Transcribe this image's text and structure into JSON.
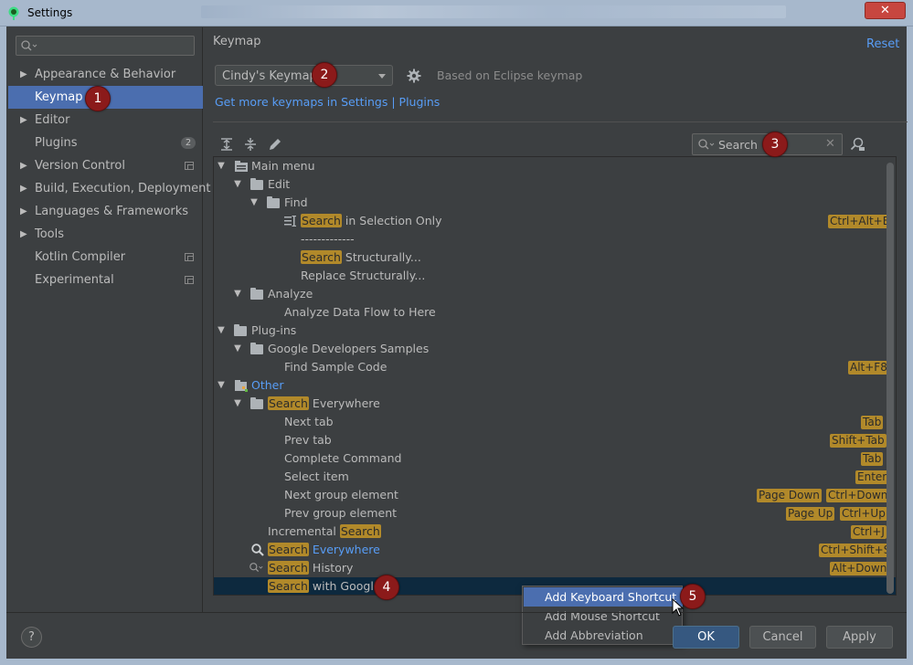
{
  "window": {
    "title": "Settings",
    "close_label": "✕"
  },
  "sidebar": {
    "search_placeholder": "",
    "items": [
      {
        "label": "Appearance & Behavior",
        "arrow": "▶"
      },
      {
        "label": "Keymap",
        "selected": true
      },
      {
        "label": "Editor",
        "arrow": "▶"
      },
      {
        "label": "Plugins",
        "badge": "2"
      },
      {
        "label": "Version Control",
        "arrow": "▶"
      },
      {
        "label": "Build, Execution, Deployment",
        "arrow": "▶"
      },
      {
        "label": "Languages & Frameworks",
        "arrow": "▶"
      },
      {
        "label": "Tools",
        "arrow": "▶"
      },
      {
        "label": "Kotlin Compiler"
      },
      {
        "label": "Experimental"
      }
    ]
  },
  "main": {
    "title": "Keymap",
    "reset_label": "Reset",
    "keymap_value": "Cindy's Keymap",
    "based_on": "Based on Eclipse keymap",
    "more_keymaps": "Get more keymaps in Settings | Plugins",
    "search_value": "Search",
    "search_clear": "✕"
  },
  "tree": {
    "expanded_glyph": "▼",
    "rows": [
      {
        "label": "Main menu"
      },
      {
        "label": "Edit"
      },
      {
        "label": "Find"
      },
      {
        "hl": "Search",
        "rest": " in Selection Only",
        "shortcuts": [
          "Ctrl+Alt+E"
        ]
      },
      {
        "label": "-------------"
      },
      {
        "hl": "Search",
        "rest": " Structurally..."
      },
      {
        "label": "Replace Structurally..."
      },
      {
        "label": "Analyze"
      },
      {
        "label": "Analyze Data Flow to Here"
      },
      {
        "label": "Plug-ins"
      },
      {
        "label": "Google Developers Samples"
      },
      {
        "label": "Find Sample Code",
        "shortcuts": [
          "Alt+F8"
        ]
      },
      {
        "label": "Other"
      },
      {
        "hl": "Search",
        "rest": " Everywhere"
      },
      {
        "label": "Next tab",
        "shortcuts": [
          "Tab"
        ]
      },
      {
        "label": "Prev tab",
        "shortcuts": [
          "Shift+Tab"
        ]
      },
      {
        "label": "Complete Command",
        "shortcuts": [
          "Tab"
        ]
      },
      {
        "label": "Select item",
        "shortcuts": [
          "Enter"
        ]
      },
      {
        "label": "Next group element",
        "shortcuts": [
          "Page Down",
          "Ctrl+Down"
        ]
      },
      {
        "label": "Prev group element",
        "shortcuts": [
          "Page Up",
          "Ctrl+Up"
        ]
      },
      {
        "pre": "Incremental ",
        "hl": "Search",
        "shortcuts": [
          "Ctrl+J"
        ]
      },
      {
        "hl": "Search",
        "rest": " Everywhere",
        "shortcuts": [
          "Ctrl+Shift+S"
        ]
      },
      {
        "hl": "Search",
        "rest": " History",
        "shortcuts": [
          "Alt+Down"
        ]
      },
      {
        "hl": "Search",
        "rest": " with Google"
      }
    ]
  },
  "context_menu": {
    "items": [
      "Add Keyboard Shortcut",
      "Add Mouse Shortcut",
      "Add Abbreviation"
    ]
  },
  "buttons": {
    "help": "?",
    "ok": "OK",
    "cancel": "Cancel",
    "apply": "Apply"
  },
  "markers": [
    "1",
    "2",
    "3",
    "4",
    "5"
  ],
  "colors": {
    "selection": "#4b6eaf",
    "highlight": "#b1892a",
    "link": "#589df6",
    "marker": "#8b1a1a"
  }
}
